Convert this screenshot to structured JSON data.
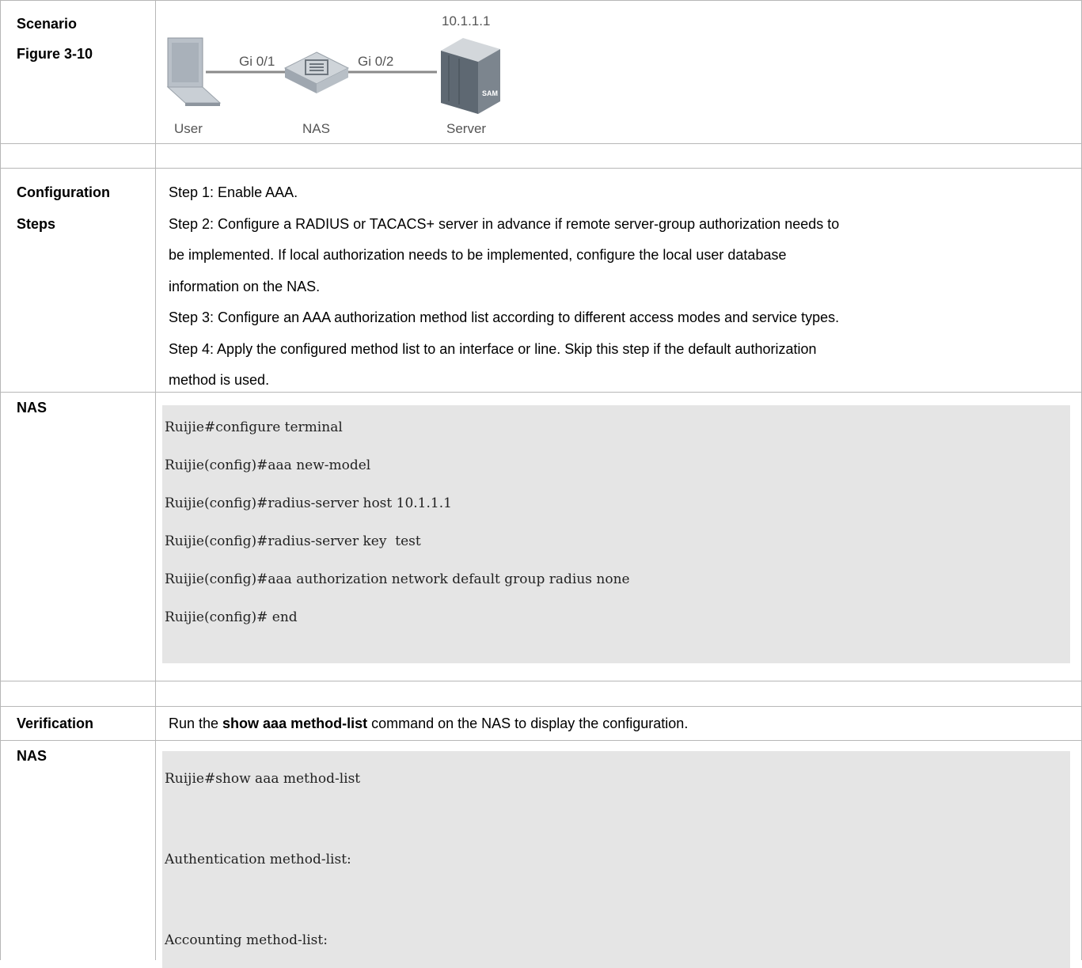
{
  "scenario": {
    "label_line1": "Scenario",
    "label_line2": "Figure 3-10",
    "figure": {
      "ip": "10.1.1.1",
      "port_left": "Gi 0/1",
      "port_right": "Gi 0/2",
      "node_user": "User",
      "node_nas": "NAS",
      "node_server": "Server",
      "server_logo": "SAM"
    }
  },
  "config": {
    "label_line1": "Configuration",
    "label_line2": "Steps",
    "lines": [
      "Step 1: Enable AAA.",
      "Step 2: Configure a RADIUS or TACACS+ server in advance if remote server-group authorization needs to",
      "be implemented. If local authorization needs to be implemented, configure the local user database",
      "information on the NAS.",
      "Step 3: Configure an AAA authorization method list according to different access modes and service types.",
      "Step 4: Apply the configured method list to an interface or line. Skip this step if the default authorization",
      "method is used."
    ]
  },
  "nas1": {
    "label": "NAS",
    "code": [
      "Ruijie#configure terminal",
      "Ruijie(config)#aaa new-model",
      "Ruijie(config)#radius-server host 10.1.1.1",
      "Ruijie(config)#radius-server key  test",
      "Ruijie(config)#aaa authorization network default group radius none",
      "Ruijie(config)# end"
    ]
  },
  "verification": {
    "label": "Verification",
    "prefix": "Run the ",
    "command": "show aaa method-list",
    "suffix": " command on the NAS to display the configuration."
  },
  "nas2": {
    "label": "NAS",
    "code": [
      "Ruijie#show aaa method-list",
      "",
      "Authentication method-list:",
      "",
      "Accounting method-list:"
    ]
  }
}
